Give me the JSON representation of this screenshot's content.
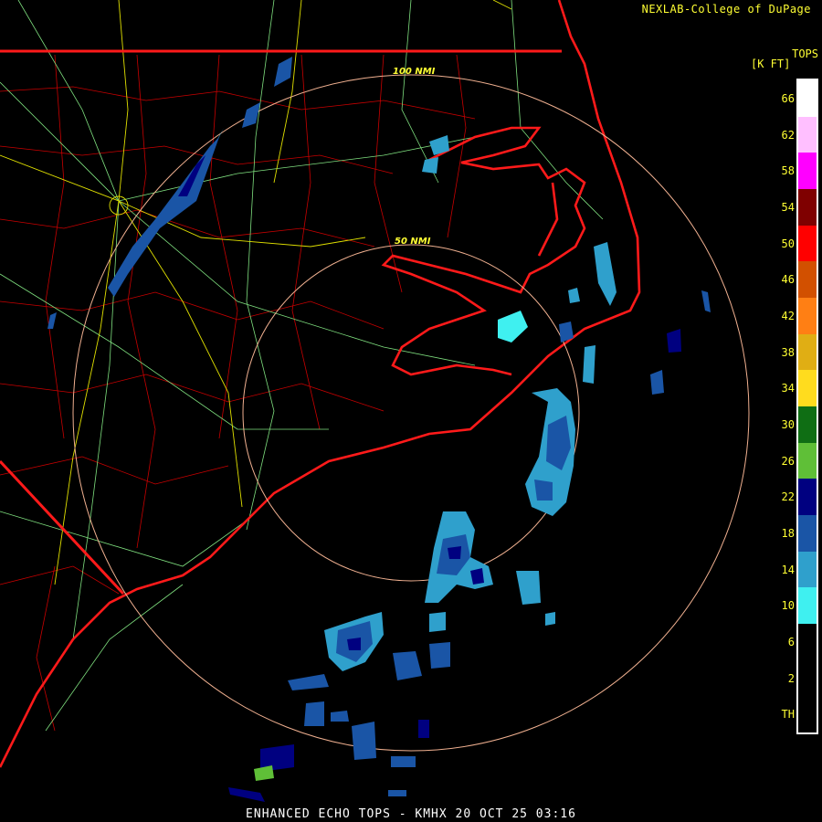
{
  "header": {
    "credit": "NEXLAB-College of DuPage"
  },
  "legend": {
    "title": "TOPS",
    "units": "[K FT]",
    "entries": [
      {
        "label": "66",
        "color": "#ffffff"
      },
      {
        "label": "62",
        "color": "#ffbfff"
      },
      {
        "label": "58",
        "color": "#ff00ff"
      },
      {
        "label": "54",
        "color": "#7f0000"
      },
      {
        "label": "50",
        "color": "#ff0000"
      },
      {
        "label": "46",
        "color": "#d25000"
      },
      {
        "label": "42",
        "color": "#ff7f14"
      },
      {
        "label": "38",
        "color": "#e0ae14"
      },
      {
        "label": "34",
        "color": "#ffdc1e"
      },
      {
        "label": "30",
        "color": "#0f6e14"
      },
      {
        "label": "26",
        "color": "#5fbf37"
      },
      {
        "label": "22",
        "color": "#000080"
      },
      {
        "label": "18",
        "color": "#1a55a6"
      },
      {
        "label": "14",
        "color": "#2fa0cc"
      },
      {
        "label": "10",
        "color": "#3ff0f0"
      },
      {
        "label": "6",
        "color": "#000000"
      },
      {
        "label": "2",
        "color": "#000000"
      }
    ],
    "labels": [
      "66",
      "62",
      "58",
      "54",
      "50",
      "46",
      "42",
      "38",
      "34",
      "30",
      "26",
      "22",
      "18",
      "14",
      "10",
      "6",
      "2",
      "TH"
    ]
  },
  "rings": {
    "outer_label": "100 NMI",
    "inner_label": "50 NMI"
  },
  "caption": "ENHANCED ECHO TOPS - KMHX 20 OCT 25 03:16"
}
